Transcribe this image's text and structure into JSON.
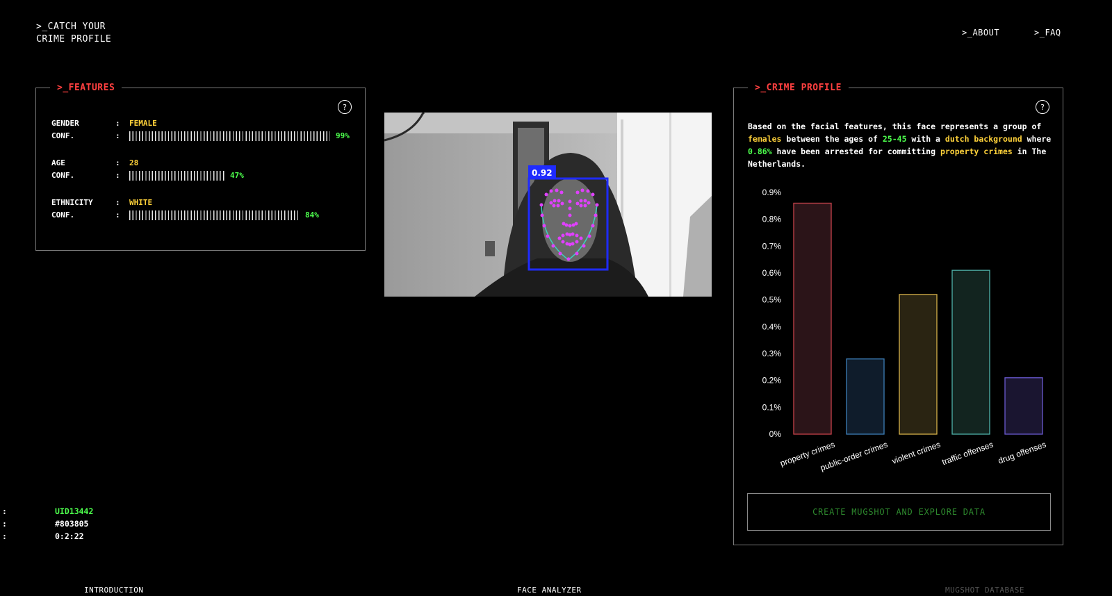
{
  "header": {
    "brand_line1": ">_CATCH YOUR",
    "brand_line2": "CRIME PROFILE",
    "nav": {
      "about": ">_ABOUT",
      "faq": ">_FAQ"
    }
  },
  "features": {
    "title": ">_FEATURES",
    "help": "?",
    "gender": {
      "label": "GENDER",
      "value": "FEMALE",
      "conf_label": "CONF.",
      "conf": "99%",
      "conf_fraction": 0.99
    },
    "age": {
      "label": "AGE",
      "value": "28",
      "conf_label": "CONF.",
      "conf": "47%",
      "conf_fraction": 0.47
    },
    "ethnicity": {
      "label": "ETHNICITY",
      "value": "WHITE",
      "conf_label": "CONF.",
      "conf": "84%",
      "conf_fraction": 0.84
    },
    "colon": ":"
  },
  "camera": {
    "detection_score": "0.92"
  },
  "crime_profile": {
    "title": ">_CRIME PROFILE",
    "help": "?",
    "desc": {
      "t1": "Based on the facial features, this face represents a group of ",
      "group": "females",
      "t2": " between the ages of ",
      "ages": "25-45",
      "t3": " with a ",
      "background": "dutch background",
      "t4": " where ",
      "percent": "0.86%",
      "t5": " have been arrested for committing ",
      "crime": "property crimes",
      "t6": " in The Netherlands."
    },
    "cta": "CREATE MUGSHOT AND EXPLORE DATA"
  },
  "chart_data": {
    "type": "bar",
    "categories": [
      "property crimes",
      "public-order crimes",
      "violent crimes",
      "traffic offenses",
      "drug offenses"
    ],
    "values": [
      0.86,
      0.28,
      0.52,
      0.61,
      0.21
    ],
    "ylim": [
      0,
      0.9
    ],
    "yticks": [
      "0%",
      "0.1%",
      "0.2%",
      "0.3%",
      "0.4%",
      "0.5%",
      "0.6%",
      "0.7%",
      "0.8%",
      "0.9%"
    ],
    "fill_colors": [
      "#2b1418",
      "#0f1c2b",
      "#2a2412",
      "#12241f",
      "#1a1530"
    ],
    "stroke_colors": [
      "#c7424a",
      "#3d7fb8",
      "#d8b24a",
      "#4fb3aa",
      "#6a5ad0"
    ],
    "grid": false,
    "legend": "none"
  },
  "session": {
    "colon": ":",
    "uid": "UID13442",
    "color": "#803805",
    "time": "0:2:22"
  },
  "bottom_nav": {
    "intro": "INTRODUCTION",
    "face": "FACE ANALYZER",
    "mugshot": "MUGSHOT DATABASE"
  }
}
